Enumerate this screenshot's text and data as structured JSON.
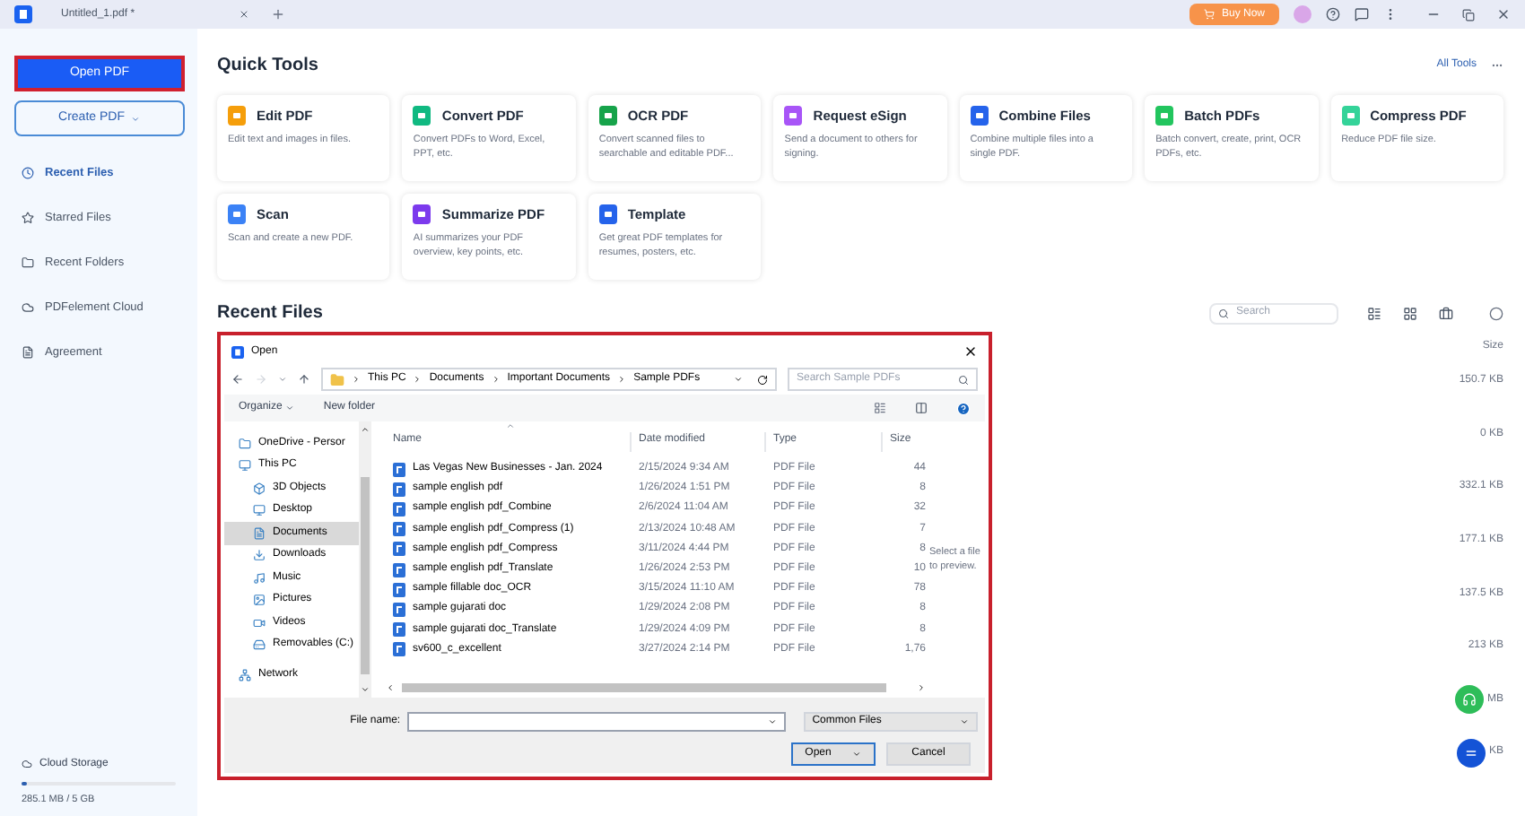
{
  "titlebar": {
    "tabs": [
      {
        "label": "Untitled_1.pdf *",
        "selected": true
      }
    ],
    "buy_button": "Buy Now"
  },
  "sidebar": {
    "open_button": "Open PDF",
    "create_button": "Create PDF",
    "items": [
      {
        "label": "Recent Files",
        "selected": true
      },
      {
        "label": "Starred Files",
        "selected": false
      },
      {
        "label": "Recent Folders",
        "selected": false
      },
      {
        "label": "PDFelement Cloud",
        "selected": false
      },
      {
        "label": "Agreement",
        "selected": false
      }
    ],
    "storage": {
      "label": "Cloud Storage",
      "level": 0.04,
      "reading": "285.1 MB / 5 GB"
    }
  },
  "quick_tools": {
    "title": "Quick Tools",
    "all_tools": "All Tools",
    "tools": [
      {
        "title": "Edit PDF",
        "description": "Edit text and images in files."
      },
      {
        "title": "Convert PDF",
        "description": "Convert PDFs to Word, Excel, PPT, etc."
      },
      {
        "title": "OCR PDF",
        "description": "Convert scanned files to searchable and editable PDF..."
      },
      {
        "title": "Request eSign",
        "description": "Send a document to others for signing."
      },
      {
        "title": "Combine Files",
        "description": "Combine multiple files into a single PDF."
      },
      {
        "title": "Batch PDFs",
        "description": "Batch convert, create, print, OCR PDFs, etc."
      },
      {
        "title": "Compress PDF",
        "description": "Reduce PDF file size."
      },
      {
        "title": "Scan",
        "description": "Scan and create a new PDF."
      },
      {
        "title": "Summarize PDF",
        "description": "AI summarizes your PDF overview, key points, etc."
      },
      {
        "title": "Template",
        "description": "Get great PDF templates for resumes, posters, etc."
      }
    ]
  },
  "recent_files": {
    "title": "Recent Files",
    "search_placeholder": "Search",
    "size_header": "Size",
    "sizes": [
      "150.7 KB",
      "0 KB",
      "332.1 KB",
      "177.1 KB",
      "137.5 KB",
      "213 KB",
      "MB",
      "KB"
    ]
  },
  "open_dialog": {
    "title": "Open",
    "path": [
      "This PC",
      "Documents",
      "Important Documents",
      "Sample PDFs"
    ],
    "search_placeholder": "Search Sample PDFs",
    "organize": "Organize",
    "new_folder": "New folder",
    "nav": [
      {
        "label": "OneDrive - Persor",
        "selected": false
      },
      {
        "label": "This PC",
        "selected": false,
        "children": [
          {
            "label": "3D Objects",
            "selected": false
          },
          {
            "label": "Desktop",
            "selected": false
          },
          {
            "label": "Documents",
            "selected": true
          },
          {
            "label": "Downloads",
            "selected": false
          },
          {
            "label": "Music",
            "selected": false
          },
          {
            "label": "Pictures",
            "selected": false
          },
          {
            "label": "Videos",
            "selected": false
          },
          {
            "label": "Removables (C:)",
            "selected": false
          }
        ]
      },
      {
        "label": "Network",
        "selected": false
      }
    ],
    "columns": [
      "Name",
      "Date modified",
      "Type",
      "Size"
    ],
    "rows": [
      [
        "Las Vegas New Businesses - Jan. 2024",
        "2/15/2024 9:34 AM",
        "PDF File",
        "44"
      ],
      [
        "sample english pdf",
        "1/26/2024 1:51 PM",
        "PDF File",
        "8"
      ],
      [
        "sample english pdf_Combine",
        "2/6/2024 11:04 AM",
        "PDF File",
        "32"
      ],
      [
        "sample english pdf_Compress (1)",
        "2/13/2024 10:48 AM",
        "PDF File",
        "7"
      ],
      [
        "sample english pdf_Compress",
        "3/11/2024 4:44 PM",
        "PDF File",
        "8"
      ],
      [
        "sample english pdf_Translate",
        "1/26/2024 2:53 PM",
        "PDF File",
        "10"
      ],
      [
        "sample fillable doc_OCR",
        "3/15/2024 11:10 AM",
        "PDF File",
        "78"
      ],
      [
        "sample gujarati doc",
        "1/29/2024 2:08 PM",
        "PDF File",
        "8"
      ],
      [
        "sample gujarati doc_Translate",
        "1/29/2024 4:09 PM",
        "PDF File",
        "8"
      ],
      [
        "sv600_c_excellent",
        "3/27/2024 2:14 PM",
        "PDF File",
        "1,76"
      ]
    ],
    "preview": "Select a file to preview.",
    "file_name_label": "File name:",
    "filter": "Common Files",
    "open_button": "Open",
    "cancel_button": "Cancel"
  }
}
